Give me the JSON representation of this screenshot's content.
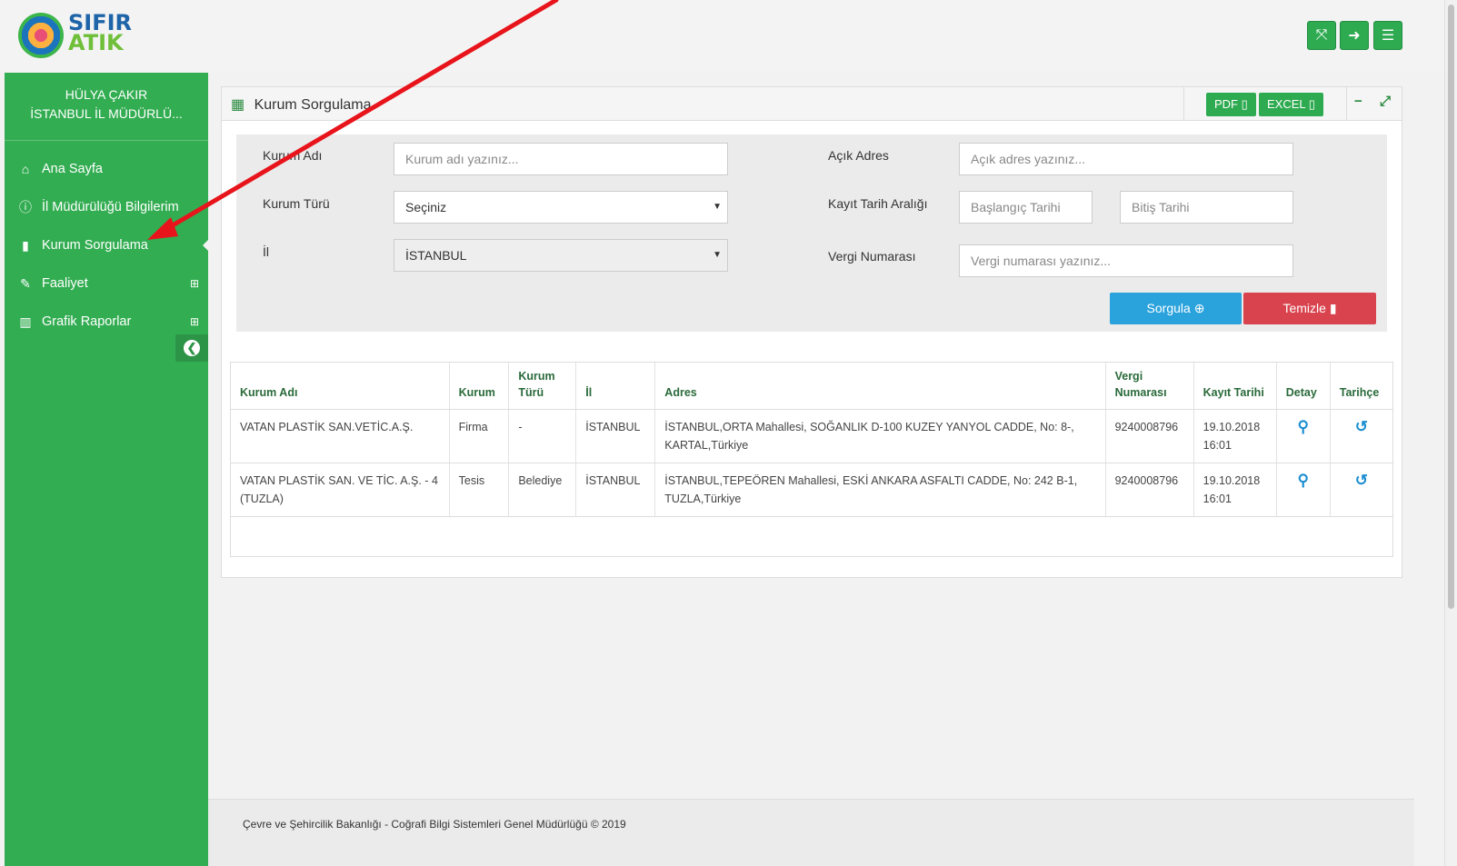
{
  "header": {
    "logo_line1": "SIFIR",
    "logo_line2": "ATIK",
    "buttons": [
      {
        "name": "fullscreen-button",
        "icon": "expand-icon"
      },
      {
        "name": "logout-button",
        "icon": "sign-out-icon"
      },
      {
        "name": "menu-button",
        "icon": "bars-icon"
      }
    ]
  },
  "sidebar": {
    "user_name": "HÜLYA ÇAKIR",
    "user_org": "İSTANBUL İL MÜDÜRLÜ...",
    "items": [
      {
        "label": "Ana Sayfa",
        "icon": "home-icon"
      },
      {
        "label": "İl Müdürülüğü Bilgilerim",
        "icon": "info-circle-icon"
      },
      {
        "label": "Kurum Sorgulama",
        "icon": "building-icon",
        "active": true
      },
      {
        "label": "Faaliyet",
        "icon": "edit-icon",
        "expandable": true
      },
      {
        "label": "Grafik Raporlar",
        "icon": "bar-chart-icon",
        "expandable": true
      }
    ],
    "expand_glyph": "⊞",
    "collapse_glyph": "➜"
  },
  "panel": {
    "title": "Kurum Sorgulama",
    "pdf_label": "PDF",
    "excel_label": "EXCEL",
    "minimize_glyph": "−",
    "expand_glyph": "⤢"
  },
  "filters": {
    "kurum_adi_label": "Kurum Adı",
    "kurum_adi_placeholder": "Kurum adı yazınız...",
    "kurum_turu_label": "Kurum Türü",
    "kurum_turu_value": "Seçiniz",
    "il_label": "İl",
    "il_value": "İSTANBUL",
    "acik_adres_label": "Açık Adres",
    "acik_adres_placeholder": "Açık adres yazınız...",
    "tarih_label": "Kayıt Tarih Aralığı",
    "baslangic_placeholder": "Başlangıç Tarihi",
    "bitis_placeholder": "Bitiş Tarihi",
    "vergi_label": "Vergi Numarası",
    "vergi_placeholder": "Vergi numarası yazınız...",
    "sorgula_label": "Sorgula",
    "temizle_label": "Temizle",
    "colors": {
      "sorgula": "#2aa3dd",
      "temizle": "#d9434e"
    }
  },
  "table": {
    "headers": [
      "Kurum Adı",
      "Kurum",
      "Kurum Türü",
      "İl",
      "Adres",
      "Vergi Numarası",
      "Kayıt Tarihi",
      "Detay",
      "Tarihçe"
    ],
    "rows": [
      {
        "kurum_adi": "VATAN PLASTİK SAN.VETİC.A.Ş.",
        "kurum": "Firma",
        "kurum_turu": "-",
        "il": "İSTANBUL",
        "adres": "İSTANBUL,ORTA Mahallesi, SOĞANLIK D-100 KUZEY YANYOL CADDE, No: 8-, KARTAL,Türkiye",
        "vergi": "9240008796",
        "tarih": "19.10.2018 16:01"
      },
      {
        "kurum_adi": "VATAN PLASTİK SAN. VE TİC. A.Ş. - 4 (TUZLA)",
        "kurum": "Tesis",
        "kurum_turu": "Belediye",
        "il": "İSTANBUL",
        "adres": "İSTANBUL,TEPEÖREN Mahallesi, ESKİ ANKARA ASFALTI CADDE, No: 242 B-1, TUZLA,Türkiye",
        "vergi": "9240008796",
        "tarih": "19.10.2018 16:01"
      }
    ]
  },
  "footer": {
    "text": "Çevre ve Şehircilik Bakanlığı - Coğrafi Bilgi Sistemleri Genel Müdürlüğü © 2019"
  },
  "colors": {
    "brand_green": "#33ad52",
    "accent_blue": "#1b8ed1",
    "annotation_arrow": "#e8141b"
  }
}
